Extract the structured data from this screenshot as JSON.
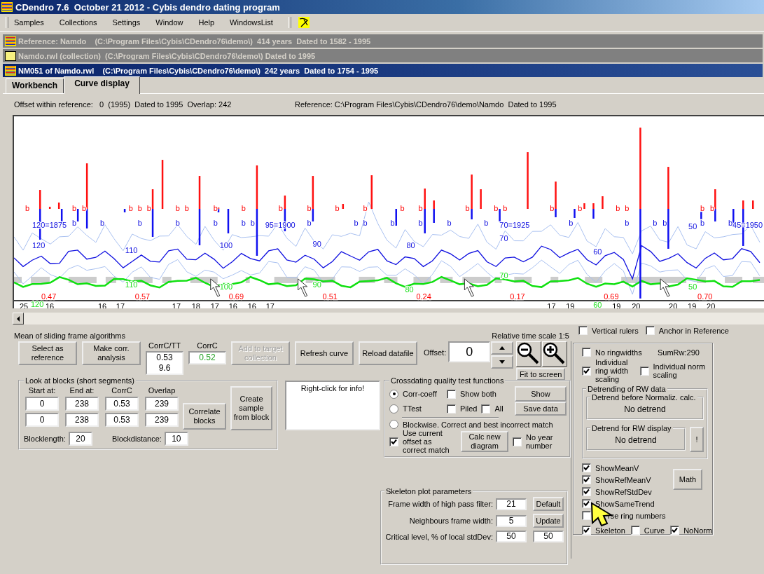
{
  "window": {
    "title": "CDendro 7.6  October 21 2012 - Cybis dendro dating program"
  },
  "menu": [
    {
      "label": "Samples"
    },
    {
      "label": "Collections"
    },
    {
      "label": "Settings"
    },
    {
      "label": "Window"
    },
    {
      "label": "Help"
    },
    {
      "label": "WindowsList"
    }
  ],
  "documents": [
    {
      "title": "Reference: Namdo    (C:\\Program Files\\Cybis\\CDendro76\\demo\\)  414 years  Dated to 1582 - 1995",
      "active": false
    },
    {
      "title": "Namdo.rwl (collection)  (C:\\Program Files\\Cybis\\CDendro76\\demo\\) Dated to 1995",
      "active": false
    },
    {
      "title": "NM051 of Namdo.rwl    (C:\\Program Files\\Cybis\\CDendro76\\demo\\)  242 years  Dated to 1754 - 1995",
      "active": true
    }
  ],
  "tabs": [
    {
      "label": "Workbench",
      "selected": false
    },
    {
      "label": "Curve display",
      "selected": true
    }
  ],
  "info": {
    "offset": "Offset within reference:   0  (1995)  Dated to 1995  Overlap: 242",
    "reference": "Reference: C:\\Program Files\\Cybis\\CDendro76\\demo\\Namdo  Dated to 1995"
  },
  "chart": {
    "upper_marks": [
      "b",
      "b",
      "b",
      "b",
      "b",
      "b",
      "b",
      "b",
      "b",
      "b",
      "b",
      "b",
      "b",
      "b",
      "b",
      "b",
      "b",
      "b",
      "b",
      "b",
      "b",
      "b",
      "b",
      "b",
      "b"
    ],
    "lower_marks": [
      "b",
      "b",
      "b",
      "b",
      "b",
      "b",
      "b",
      "b",
      "b",
      "b",
      "b",
      "b",
      "b",
      "b",
      "b",
      "b",
      "b",
      "b",
      "b",
      "b"
    ],
    "year_labels": [
      "120=1875",
      "95=1900",
      "70=1925",
      "45=1950"
    ],
    "mean_labels": [
      "120",
      "110",
      "100",
      "90",
      "80",
      "70",
      "60",
      "50"
    ],
    "trend_labels": [
      "120",
      "110",
      "100",
      "90",
      "80",
      "70",
      "60",
      "50"
    ],
    "correlations": [
      "0.47",
      "0.57",
      "0.69",
      "0.51",
      "0.24",
      "0.17",
      "0.69",
      "0.70"
    ],
    "axis_labels": [
      "25",
      "16",
      "16",
      "17",
      "17",
      "18",
      "17",
      "16",
      "16",
      "17",
      "17",
      "19",
      "19",
      "20",
      "20",
      "19",
      "20"
    ]
  },
  "panel": {
    "caption": "Mean of sliding frame algorithms",
    "time_scale": "Relative time scale 1:5",
    "items": [
      {
        "kind": "button",
        "label": "Select as reference",
        "disabled": false
      },
      {
        "kind": "button",
        "label": "Make corr. analysis",
        "disabled": false
      },
      {
        "kind": "readout",
        "label": "CorrC/TT",
        "lines": [
          "0.53",
          "9.6"
        ],
        "color": "#000000"
      },
      {
        "kind": "readout",
        "label": "CorrC",
        "lines": [
          "0.52"
        ],
        "color": "#20a020"
      },
      {
        "kind": "button",
        "label": "Add to target collection",
        "disabled": true
      },
      {
        "kind": "button",
        "label": "Refresh curve",
        "disabled": false
      },
      {
        "kind": "button",
        "label": "Reload datafile",
        "disabled": false
      }
    ],
    "offset": {
      "label": "Offset:",
      "value": "0"
    },
    "fit_button": "Fit to screen"
  },
  "blocks": {
    "title": "Look at blocks (short segments)",
    "columns": [
      "Start at:",
      "End at:",
      "CorrC",
      "Overlap"
    ],
    "rows": [
      [
        "0",
        "238",
        "0.53",
        "239"
      ],
      [
        "0",
        "238",
        "0.53",
        "239"
      ]
    ],
    "correlate_button": "Correlate blocks",
    "create_button": "Create sample from block",
    "blocklength": {
      "label": "Blocklength:",
      "value": "20"
    },
    "blockdistance": {
      "label": "Blockdistance:",
      "value": "10"
    }
  },
  "info_box": "Right-click for info!",
  "crossdating": {
    "title": "Crossdating quality test functions",
    "corr": {
      "label": "Corr-coeff",
      "selected": true
    },
    "show_both": {
      "label": "Show both",
      "checked": false
    },
    "show_button": "Show",
    "ttest": {
      "label": "TTest",
      "selected": false
    },
    "piled": {
      "label": "Piled",
      "checked": false
    },
    "all": {
      "label": "All",
      "checked": false
    },
    "save_button": "Save data",
    "blockwise": {
      "label": "Blockwise. Correct and best incorrect match",
      "selected": false
    },
    "use_offset": {
      "label": "Use current offset as correct match",
      "checked": true
    },
    "calc_button": "Calc new diagram",
    "no_year": {
      "label": "No year number",
      "checked": false
    }
  },
  "skeleton": {
    "title": "Skeleton plot parameters",
    "rows": [
      {
        "label": "Frame width of high pass filter:",
        "value": "21",
        "button": "Default"
      },
      {
        "label": "Neighbours frame width:",
        "value": "5",
        "button": "Update"
      },
      {
        "label": "Critical level, % of local stdDev:",
        "value": "50",
        "value2": "50"
      }
    ]
  },
  "display": {
    "vertical_rulers": {
      "label": "Vertical rulers",
      "checked": false
    },
    "anchor": {
      "label": "Anchor in Reference",
      "checked": false
    },
    "no_ringwidths": {
      "label": "No ringwidths",
      "checked": false
    },
    "sumrw": "SumRw:290",
    "ring_scaling": {
      "label": "Individual ring width scaling",
      "checked": true
    },
    "norm_scaling": {
      "label": "Individual norm scaling",
      "checked": false
    },
    "detrending": {
      "title": "Detrending of RW data",
      "before": {
        "title": "Detrend before Normaliz. calc.",
        "value": "No detrend"
      },
      "for_display": {
        "title": "Detrend for RW display",
        "value": "No detrend"
      },
      "button": "!"
    },
    "show_options": [
      {
        "label": "ShowMeanV",
        "checked": true
      },
      {
        "label": "ShowRefMeanV",
        "checked": true
      },
      {
        "label": "ShowRefStdDev",
        "checked": true
      },
      {
        "label": "ShowSameTrend",
        "checked": true
      },
      {
        "label": "rse ring numbers",
        "checked": false
      }
    ],
    "math_button": "Math",
    "bottom_options": [
      {
        "label": "Skeleton",
        "checked": true
      },
      {
        "label": "Curve",
        "checked": false
      },
      {
        "label": "NoNorm",
        "checked": true
      }
    ]
  }
}
